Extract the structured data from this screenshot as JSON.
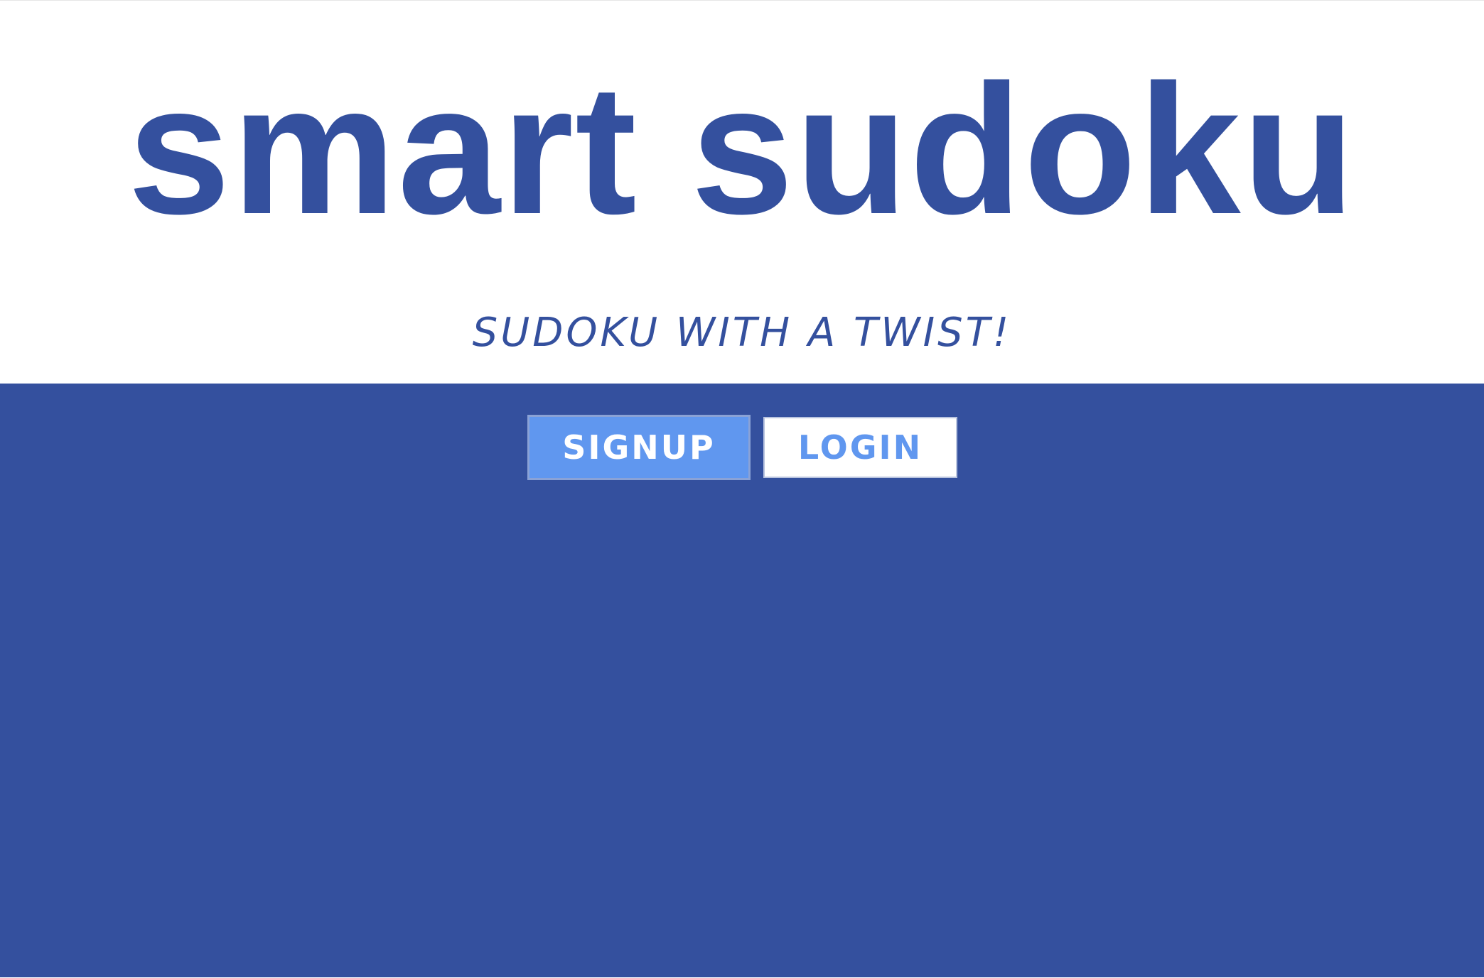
{
  "header": {
    "title": "smart sudoku",
    "tagline": "SUDOKU WITH A TWIST!"
  },
  "actions": {
    "signup_label": "SIGNUP",
    "login_label": "LOGIN"
  },
  "colors": {
    "brand": "#34509e",
    "accent": "#6097ef",
    "background": "#ffffff"
  }
}
